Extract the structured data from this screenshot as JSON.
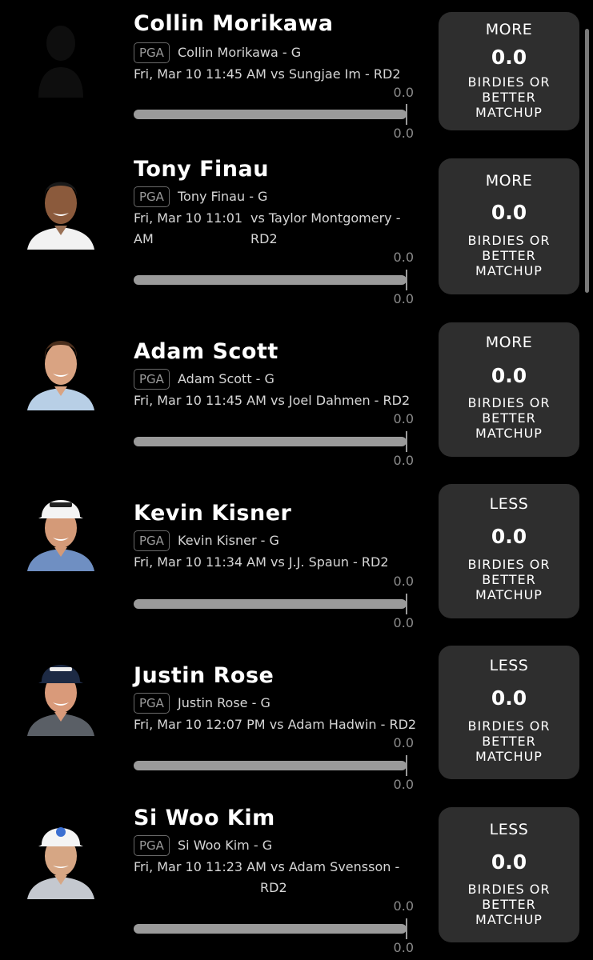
{
  "players": [
    {
      "name": "Collin Morikawa",
      "league": "PGA",
      "subtitle": "Collin Morikawa - G",
      "game_line1": "Fri, Mar 10 11:45 AM  vs Sungjae Im - RD2",
      "game_line2": "",
      "progress_top": "0.0",
      "progress_bottom": "0.0",
      "pick_direction": "MORE",
      "pick_value": "0.0",
      "pick_category_1": "BIRDIES OR",
      "pick_category_2": "BETTER",
      "pick_category_3": "MATCHUP",
      "avatar": "placeholder-silhouette"
    },
    {
      "name": "Tony Finau",
      "league": "PGA",
      "subtitle": "Tony Finau - G",
      "game_line1": "Fri, Mar 10 11:01",
      "game_line1b": "vs Taylor Montgomery -",
      "game_line2": "AM",
      "game_line2b": "RD2",
      "progress_top": "0.0",
      "progress_bottom": "0.0",
      "pick_direction": "MORE",
      "pick_value": "0.0",
      "pick_category_1": "BIRDIES OR",
      "pick_category_2": "BETTER",
      "pick_category_3": "MATCHUP",
      "avatar": "player-photo"
    },
    {
      "name": "Adam Scott",
      "league": "PGA",
      "subtitle": "Adam Scott - G",
      "game_line1": "Fri, Mar 10 11:45 AM  vs Joel Dahmen - RD2",
      "game_line2": "",
      "progress_top": "0.0",
      "progress_bottom": "0.0",
      "pick_direction": "MORE",
      "pick_value": "0.0",
      "pick_category_1": "BIRDIES OR",
      "pick_category_2": "BETTER",
      "pick_category_3": "MATCHUP",
      "avatar": "player-photo"
    },
    {
      "name": "Kevin Kisner",
      "league": "PGA",
      "subtitle": "Kevin Kisner - G",
      "game_line1": "Fri, Mar 10 11:34 AM  vs J.J. Spaun - RD2",
      "game_line2": "",
      "progress_top": "0.0",
      "progress_bottom": "0.0",
      "pick_direction": "LESS",
      "pick_value": "0.0",
      "pick_category_1": "BIRDIES OR",
      "pick_category_2": "BETTER",
      "pick_category_3": "MATCHUP",
      "avatar": "player-photo"
    },
    {
      "name": "Justin Rose",
      "league": "PGA",
      "subtitle": "Justin Rose - G",
      "game_line1": "Fri, Mar 10 12:07 PM  vs Adam Hadwin - RD2",
      "game_line2": "",
      "progress_top": "0.0",
      "progress_bottom": "0.0",
      "pick_direction": "LESS",
      "pick_value": "0.0",
      "pick_category_1": "BIRDIES OR",
      "pick_category_2": "BETTER",
      "pick_category_3": "MATCHUP",
      "avatar": "player-photo"
    },
    {
      "name": "Si Woo Kim",
      "league": "PGA",
      "subtitle": "Si Woo Kim - G",
      "game_line1": "Fri, Mar 10 11:23 AM vs Adam Svensson -",
      "game_line2": "RD2",
      "progress_top": "0.0",
      "progress_bottom": "0.0",
      "pick_direction": "LESS",
      "pick_value": "0.0",
      "pick_category_1": "BIRDIES OR",
      "pick_category_2": "BETTER",
      "pick_category_3": "MATCHUP",
      "avatar": "player-photo"
    }
  ],
  "colors": {
    "background": "#000000",
    "card": "#2e2e2e",
    "progress_track": "#9a9a9a",
    "muted_text": "#8a8a8a"
  }
}
